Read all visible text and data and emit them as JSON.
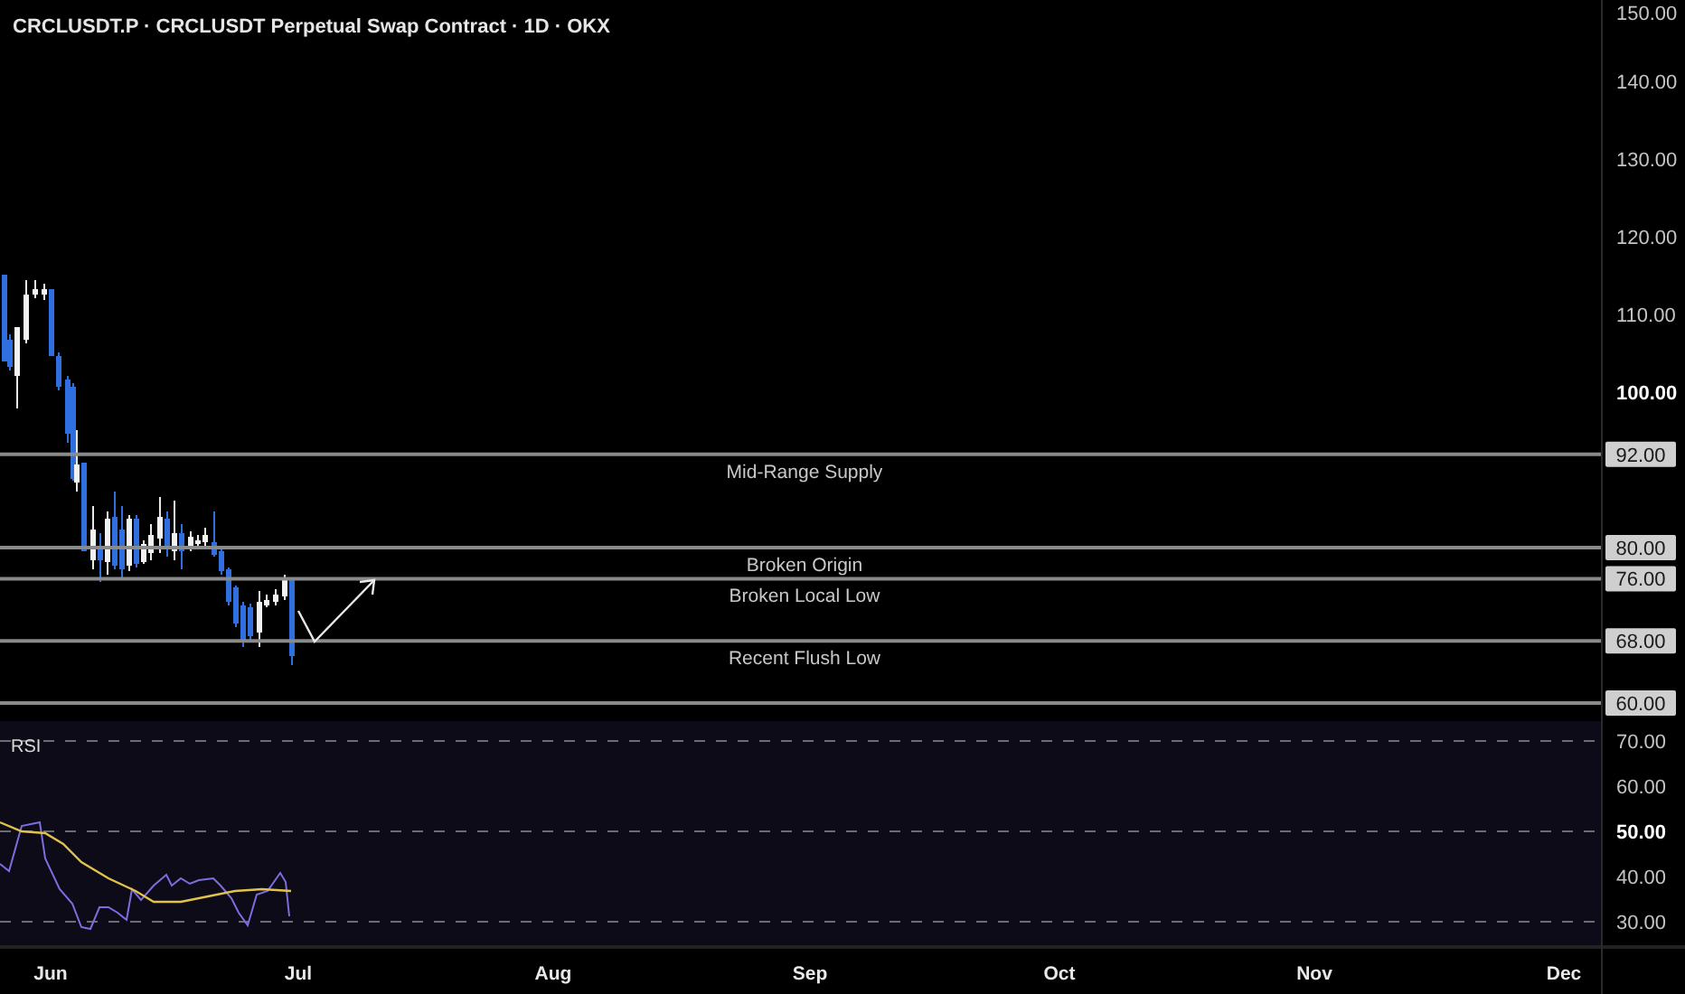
{
  "header": {
    "title": "CRCLUSDT.P · CRCLUSDT Perpetual Swap Contract · 1D · OKX"
  },
  "price_pane": {
    "axis_labels": [
      {
        "label": "150.00",
        "emphasis": false
      },
      {
        "label": "140.00",
        "emphasis": false
      },
      {
        "label": "130.00",
        "emphasis": false
      },
      {
        "label": "120.00",
        "emphasis": false
      },
      {
        "label": "110.00",
        "emphasis": false
      },
      {
        "label": "100.00",
        "emphasis": true
      }
    ],
    "levels": [
      {
        "label": "Mid-Range Supply",
        "price": "92.00"
      },
      {
        "label": "Broken Origin",
        "price": "80.00"
      },
      {
        "label": "Broken Local Low",
        "price": "76.00"
      },
      {
        "label": "Recent Flush Low",
        "price": "68.00"
      },
      {
        "price": "60.00"
      }
    ]
  },
  "rsi_pane": {
    "title": "RSI",
    "axis_labels": [
      {
        "label": "70.00",
        "emphasis": false
      },
      {
        "label": "60.00",
        "emphasis": false
      },
      {
        "label": "50.00",
        "emphasis": true
      },
      {
        "label": "40.00",
        "emphasis": false
      },
      {
        "label": "30.00",
        "emphasis": false
      }
    ]
  },
  "time_axis": [
    "Jun",
    "Jul",
    "Aug",
    "Sep",
    "Oct",
    "Nov",
    "Dec"
  ]
}
